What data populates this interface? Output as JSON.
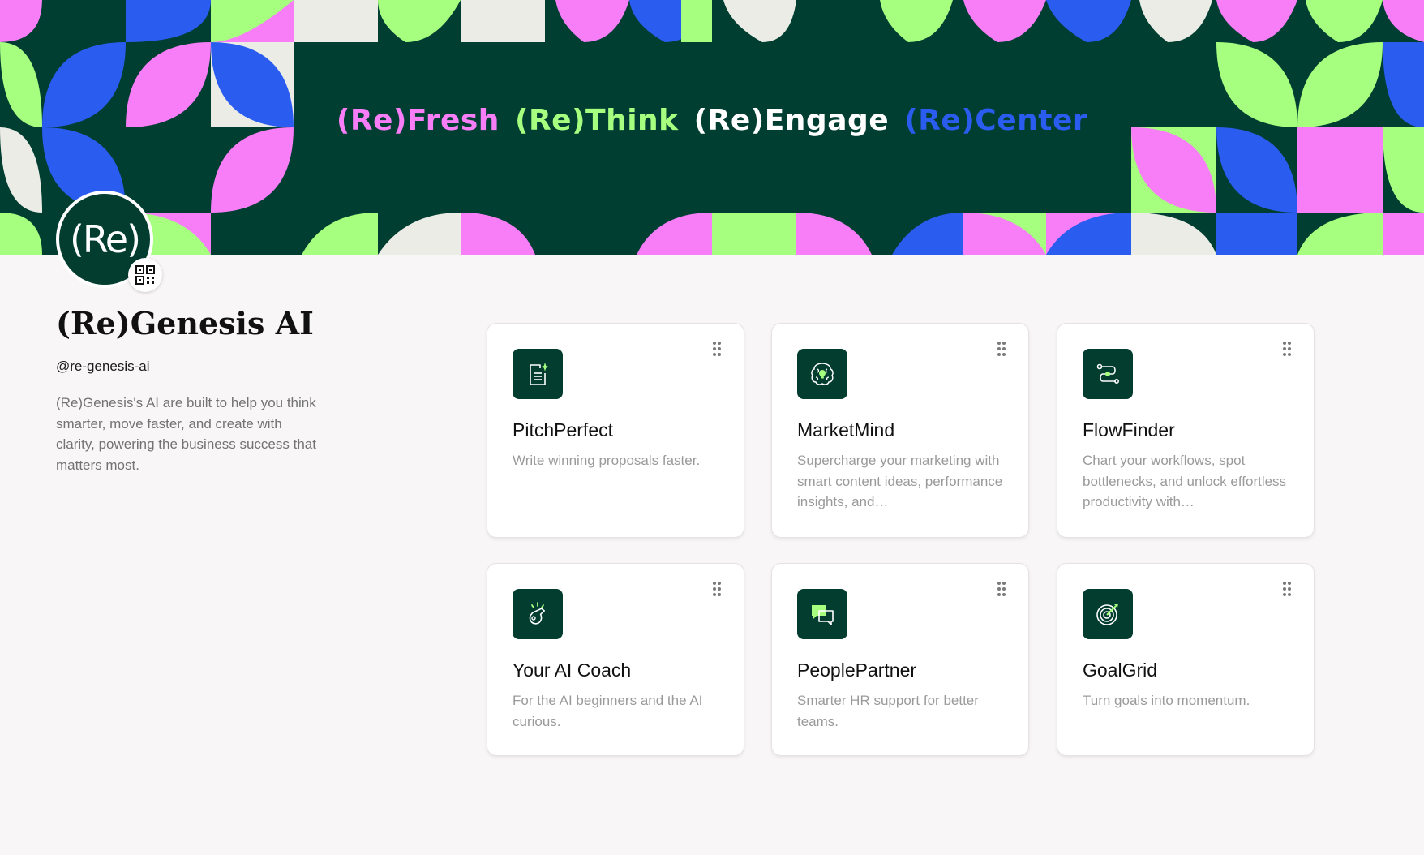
{
  "banner": {
    "tagline": [
      {
        "text": "(Re)Fresh",
        "color": "#f77ef7"
      },
      {
        "text": "(Re)Think",
        "color": "#a6ff7f"
      },
      {
        "text": "(Re)Engage",
        "color": "#ffffff"
      },
      {
        "text": "(Re)Center",
        "color": "#2a5cf0"
      }
    ]
  },
  "profile": {
    "avatar_text_a": "(R",
    "avatar_text_b": "e)",
    "name": "(Re)Genesis AI",
    "handle": "@re-genesis-ai",
    "bio": "(Re)Genesis's AI are built to help you think smarter, move faster, and create with clarity, powering the business success that matters most.",
    "qr_icon": "qr-code-icon"
  },
  "cards": [
    {
      "title": "PitchPerfect",
      "description": "Write winning proposals faster.",
      "icon": "document-sparkle-icon"
    },
    {
      "title": "MarketMind",
      "description": "Supercharge your marketing with smart content ideas, performance insights, and…",
      "icon": "brain-bulb-icon"
    },
    {
      "title": "FlowFinder",
      "description": "Chart your workflows, spot bottlenecks, and unlock effortless productivity with…",
      "icon": "workflow-path-icon"
    },
    {
      "title": "Your AI Coach",
      "description": "For the AI beginners and the AI curious.",
      "icon": "whistle-icon"
    },
    {
      "title": "PeoplePartner",
      "description": "Smarter HR support for better teams.",
      "icon": "chat-bubbles-icon"
    },
    {
      "title": "GoalGrid",
      "description": "Turn goals into momentum.",
      "icon": "target-icon"
    }
  ],
  "colors": {
    "brand_dark": "#003e31",
    "brand_green": "#a6ff7f",
    "brand_pink": "#f77ef7",
    "brand_blue": "#2a5cf0",
    "brand_cream": "#ecece6"
  }
}
